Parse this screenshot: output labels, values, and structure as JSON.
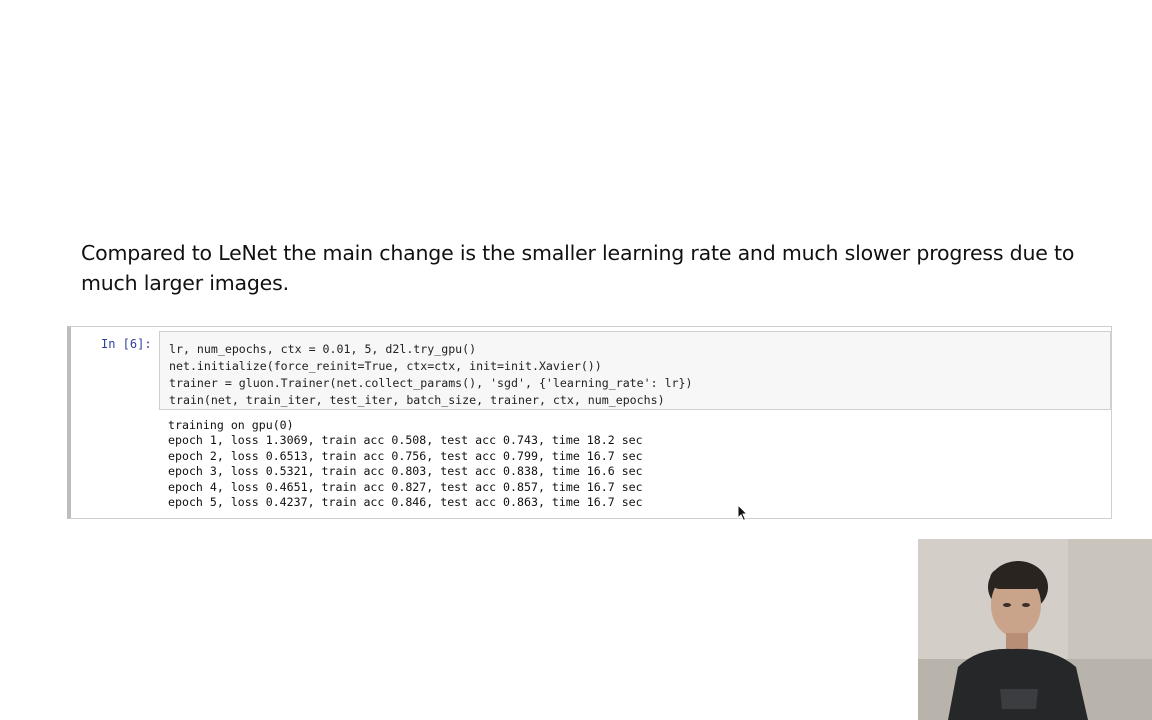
{
  "prose": {
    "text": "Compared to LeNet the main change is the smaller learning rate and much slower progress due to much larger images."
  },
  "cell": {
    "prompt": "In [6]:",
    "code_lines": [
      "lr, num_epochs, ctx = 0.01, 5, d2l.try_gpu()",
      "net.initialize(force_reinit=True, ctx=ctx, init=init.Xavier())",
      "trainer = gluon.Trainer(net.collect_params(), 'sgd', {'learning_rate': lr})",
      "train(net, train_iter, test_iter, batch_size, trainer, ctx, num_epochs)"
    ],
    "output_lines": [
      "training on gpu(0)",
      "epoch 1, loss 1.3069, train acc 0.508, test acc 0.743, time 18.2 sec",
      "epoch 2, loss 0.6513, train acc 0.756, test acc 0.799, time 16.7 sec",
      "epoch 3, loss 0.5321, train acc 0.803, test acc 0.838, time 16.6 sec",
      "epoch 4, loss 0.4651, train acc 0.827, test acc 0.857, time 16.7 sec",
      "epoch 5, loss 0.4237, train acc 0.846, test acc 0.863, time 16.7 sec"
    ]
  },
  "icons": {
    "cursor": "mouse-pointer-icon"
  }
}
